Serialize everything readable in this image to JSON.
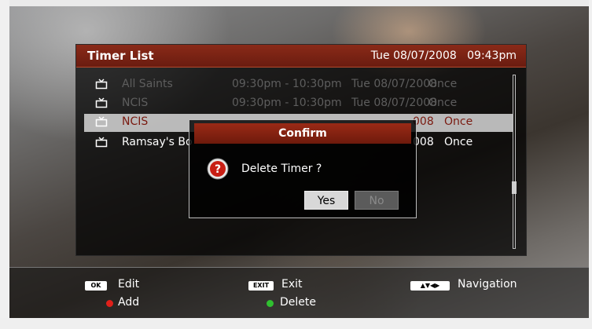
{
  "timer_list": {
    "title": "Timer List",
    "datetime": "Tue 08/07/2008   09:43pm",
    "rows": [
      {
        "name": "All Saints",
        "time": "09:30pm - 10:30pm",
        "date": "Tue 08/07/2008",
        "repeat": "Once"
      },
      {
        "name": "NCIS",
        "time": "09:30pm - 10:30pm",
        "date": "Tue 08/07/2008",
        "repeat": "Once"
      },
      {
        "name": "NCIS",
        "time": "",
        "date": "008",
        "repeat": "Once"
      },
      {
        "name": "Ramsay's Bo",
        "time": "",
        "date": "008",
        "repeat": "Once"
      }
    ]
  },
  "confirm": {
    "title": "Confirm",
    "message": "Delete Timer ?",
    "yes_label": "Yes",
    "no_label": "No",
    "question_glyph": "?"
  },
  "help": {
    "ok_key": "OK",
    "edit_label": "Edit",
    "exit_key": "EXIT",
    "exit_label": "Exit",
    "nav_key": "▲▼◀▶",
    "nav_label": "Navigation",
    "add_label": "Add",
    "delete_label": "Delete"
  },
  "colors": {
    "header_red": "#8a2a18",
    "red_dot": "#e0201a",
    "green_dot": "#30c030",
    "selected_text": "#7a1a10"
  },
  "icons": {
    "row_icon": "tv-icon",
    "dialog_icon": "question-icon"
  }
}
